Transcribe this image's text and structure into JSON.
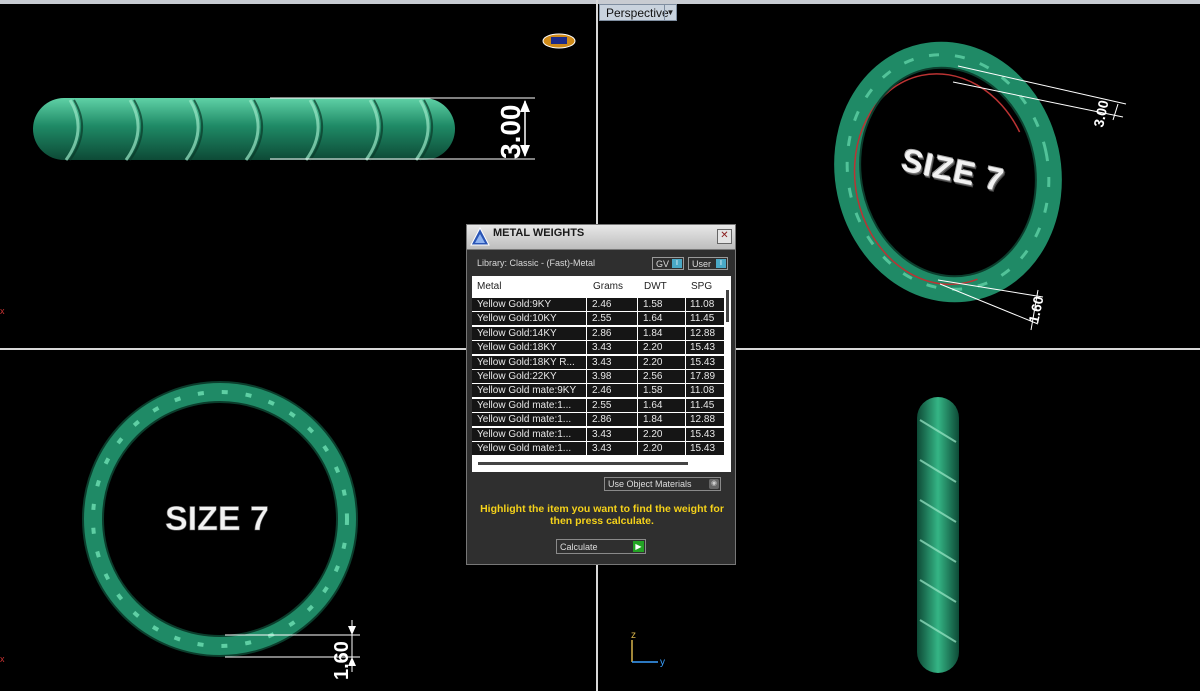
{
  "viewports": {
    "perspective_label": "Perspective",
    "size_label": "SIZE 7",
    "dim_top": "3.00",
    "dim_persp_top": "3.00",
    "dim_persp_bottom": "1.60",
    "dim_bottom": "1.60",
    "axis_z": "z",
    "axis_y": "y",
    "axis_x": "x"
  },
  "dialog": {
    "title": "METAL WEIGHTS",
    "library": "Library: Classic - (Fast)-Metal",
    "gv_label": "GV",
    "user_label": "User",
    "columns": [
      "Metal",
      "Grams",
      "DWT",
      "SPG"
    ],
    "rows": [
      [
        "Yellow Gold:9KY",
        "2.46",
        "1.58",
        "11.08"
      ],
      [
        "Yellow Gold:10KY",
        "2.55",
        "1.64",
        "11.45"
      ],
      [
        "Yellow Gold:14KY",
        "2.86",
        "1.84",
        "12.88"
      ],
      [
        "Yellow Gold:18KY",
        "3.43",
        "2.20",
        "15.43"
      ],
      [
        "Yellow Gold:18KY R...",
        "3.43",
        "2.20",
        "15.43"
      ],
      [
        "Yellow Gold:22KY",
        "3.98",
        "2.56",
        "17.89"
      ],
      [
        "Yellow Gold mate:9KY",
        "2.46",
        "1.58",
        "11.08"
      ],
      [
        "Yellow Gold mate:1...",
        "2.55",
        "1.64",
        "11.45"
      ],
      [
        "Yellow Gold mate:1...",
        "2.86",
        "1.84",
        "12.88"
      ],
      [
        "Yellow Gold mate:1...",
        "3.43",
        "2.20",
        "15.43"
      ],
      [
        "Yellow Gold mate:1...",
        "3.43",
        "2.20",
        "15.43"
      ]
    ],
    "use_object_materials": "Use Object Materials",
    "hint": "Highlight the item you want to find the weight for then press calculate.",
    "calculate_label": "Calculate"
  },
  "colors": {
    "ring_green": "#1f8a66",
    "ring_light": "#5fd1a6",
    "hint_yellow": "#f5d21a",
    "grid_line": "#d8d8d8"
  }
}
